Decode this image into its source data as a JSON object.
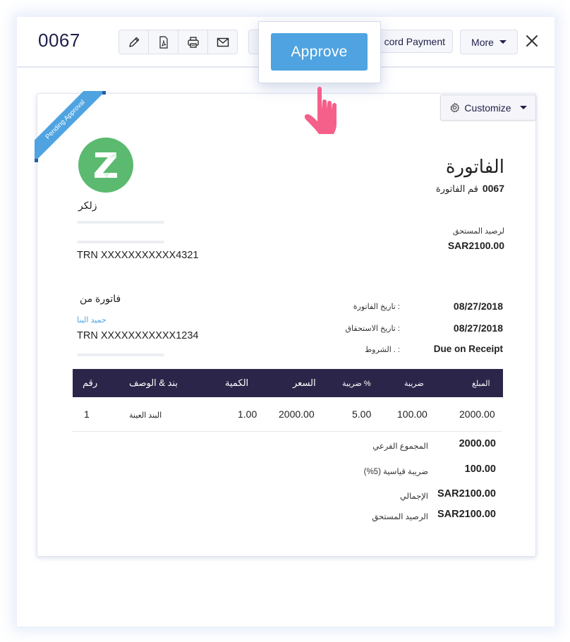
{
  "header": {
    "invoice_number": "0067",
    "toolbar_icons": [
      {
        "name": "edit",
        "icon": "pencil-icon"
      },
      {
        "name": "pdf",
        "icon": "pdf-icon"
      },
      {
        "name": "print",
        "icon": "printer-icon"
      },
      {
        "name": "email",
        "icon": "envelope-icon"
      }
    ],
    "record_payment_label": "cord Payment",
    "more_label": "More",
    "close_icon": "close-icon"
  },
  "popover": {
    "approve_label": "Approve",
    "cursor_icon": "hand-pointer-icon",
    "cursor_color": "#f5608a"
  },
  "document": {
    "status_ribbon": "Pending Approval",
    "customize_label": "Customize",
    "logo_letter": "Z",
    "org_name": "زلكر",
    "org_trn": "TRN XXXXXXXXXXX4321",
    "title": "الفاتورة",
    "invoice_number_label": "قم الفاتورة",
    "invoice_number": "0067",
    "balance_due_label": "لرصيد المستحق",
    "balance_due": "SAR2100.00",
    "bill_from_label": "فاتورة من",
    "customer_name": "حميد البنا",
    "customer_trn": "TRN XXXXXXXXXXX1234",
    "meta": [
      {
        "label": "تاريخ الفاتورة :",
        "value": "08/27/2018"
      },
      {
        "label": "تاريخ الاستحقاق :",
        "value": "08/27/2018"
      },
      {
        "label": "الشروط . :",
        "value": "Due on Receipt"
      }
    ],
    "table": {
      "headers": [
        "رقم",
        "بند & الوصف",
        "الكمية",
        "السعر",
        "ضريبة %",
        "ضريبة",
        "المبلغ"
      ],
      "rows": [
        {
          "no": "1",
          "item": "البند العينة",
          "qty": "1.00",
          "rate": "2000.00",
          "tax_pct": "5.00",
          "tax": "100.00",
          "amount": "2000.00"
        }
      ]
    },
    "totals": [
      {
        "label": "المجموع الفرعي",
        "value": "2000.00"
      },
      {
        "label": "ضريبة قياسية (5%)",
        "value": "100.00"
      },
      {
        "label": "الإجمالي",
        "value": "SAR2100.00"
      },
      {
        "label": "الرصيد المستحق",
        "value": "SAR2100.00"
      }
    ]
  },
  "colors": {
    "accent": "#4ea3e0",
    "table_header": "#2b2649",
    "logo_green": "#5bba6f",
    "title_text": "#1e1e4a"
  }
}
